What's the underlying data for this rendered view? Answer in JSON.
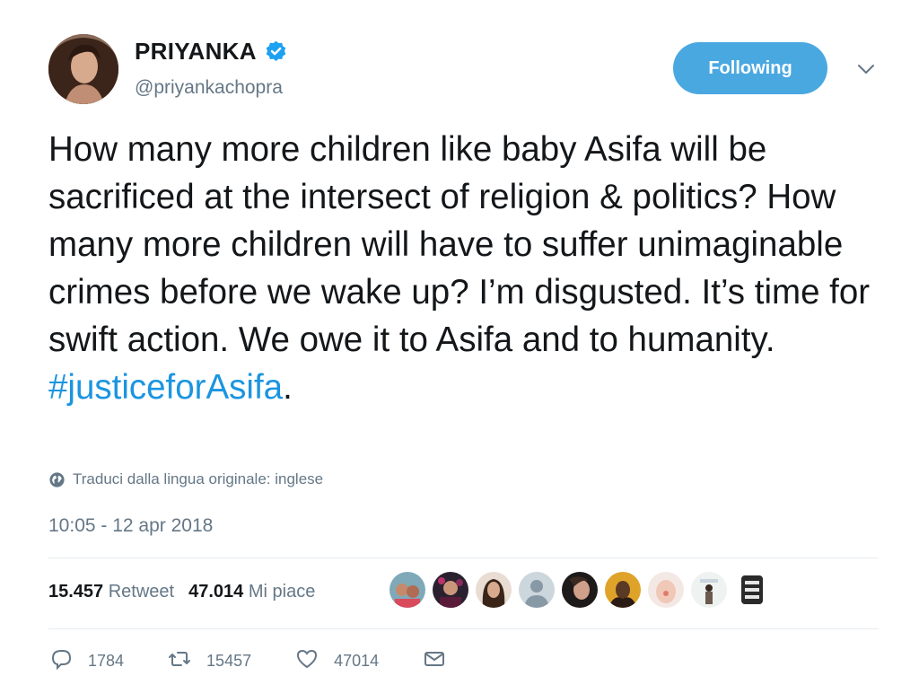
{
  "author": {
    "name": "PRIYANKA",
    "handle": "@priyankachopra",
    "follow_label": "Following"
  },
  "tweet": {
    "text": "How many more children like baby Asifa will be sacrificed at the intersect of religion & politics? How many more children will have to suffer unimaginable crimes before we wake up? I’m disgusted. It’s time for swift action. We owe it to Asifa and to humanity. ",
    "hashtag": "#justiceforAsifa",
    "trailing": ".",
    "translate_label": "Traduci dalla lingua originale: inglese",
    "timestamp": "10:05 - 12 apr 2018"
  },
  "stats": {
    "retweets_count": "15.457",
    "retweets_label": "Retweet",
    "likes_count": "47.014",
    "likes_label": "Mi piace"
  },
  "actions": {
    "reply_count": "1784",
    "retweet_count": "15457",
    "like_count": "47014"
  },
  "colors": {
    "accent": "#1b95e0",
    "follow_button": "#4aa8e0",
    "secondary_text": "#657786"
  },
  "icons": [
    "verified-badge-icon",
    "chevron-down-icon",
    "globe-icon",
    "reply-icon",
    "retweet-icon",
    "heart-icon",
    "direct-message-icon"
  ]
}
